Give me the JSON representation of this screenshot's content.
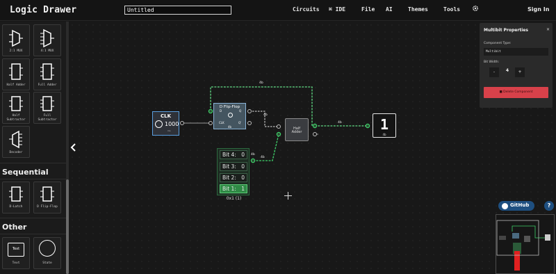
{
  "app": {
    "title": "Logic Drawer",
    "document_name": "Untitled",
    "nav": [
      {
        "label": "Circuits"
      },
      {
        "label": "IDE"
      },
      {
        "label": "File"
      },
      {
        "label": "AI"
      },
      {
        "label": "Themes"
      },
      {
        "label": "Tools"
      }
    ],
    "settings_icon": "gear-icon",
    "signin_label": "Sign In"
  },
  "sidebar": {
    "components": [
      {
        "label": "2:1 MUX",
        "icon": "mux-icon"
      },
      {
        "label": "4:1 MUX",
        "icon": "mux-icon"
      },
      {
        "label": "Half Adder",
        "icon": "chip-icon"
      },
      {
        "label": "Full Adder",
        "icon": "chip-icon"
      },
      {
        "label": "Half",
        "label2": "Subtractor",
        "icon": "chip-icon"
      },
      {
        "label": "Full",
        "label2": "Subtractor",
        "icon": "chip-icon"
      },
      {
        "label": "Decoder",
        "icon": "decoder-icon"
      }
    ],
    "sections": {
      "sequential": "Sequential",
      "other": "Other"
    },
    "sequential_components": [
      {
        "label": "D-Latch",
        "icon": "chip-icon"
      },
      {
        "label": "D Flip-Flop",
        "icon": "chip-icon"
      }
    ],
    "other_components": [
      {
        "label": "Text",
        "icon": "text-box-icon",
        "inner": "Text"
      },
      {
        "label": "State",
        "icon": "state-circle-icon"
      }
    ]
  },
  "canvas": {
    "clock": {
      "title": "CLK",
      "value": "1000",
      "unit": "ms"
    },
    "flip_flop": {
      "title": "D Flip-Flop",
      "pin_d": "D",
      "pin_q": "Q",
      "pin_clk": "CLK",
      "pin_qbar": "Q'",
      "width": "4b"
    },
    "half_adder": {
      "line1": "Half",
      "line2": "Adder"
    },
    "hex_display": {
      "digit": "1",
      "width": "4b"
    },
    "multibit": {
      "rows": [
        {
          "label": "Bit 4:",
          "value": "0",
          "active": false
        },
        {
          "label": "Bit 3:",
          "value": "0",
          "active": false
        },
        {
          "label": "Bit 2:",
          "value": "0",
          "active": false
        },
        {
          "label": "Bit 1:",
          "value": "1",
          "active": true
        }
      ],
      "caption": "0x1 (1)"
    },
    "wire_labels": [
      "4b",
      "4b",
      "4b",
      "4b",
      "4b"
    ]
  },
  "properties": {
    "header": "Multibit Properties",
    "close": "×",
    "component_type_label": "Component Type:",
    "component_type_value": "Multibit",
    "bit_width_label": "Bit Width:",
    "decrement": "-",
    "bit_width_value": "4",
    "increment": "+",
    "delete_label": "Delete Component"
  },
  "footer": {
    "github_label": "GitHub",
    "help_label": "?"
  },
  "colors": {
    "accent_green": "#3fd16a",
    "accent_blue": "#5a9fe0",
    "delete_red": "#d8414a",
    "github_blue": "#1e4f80"
  }
}
